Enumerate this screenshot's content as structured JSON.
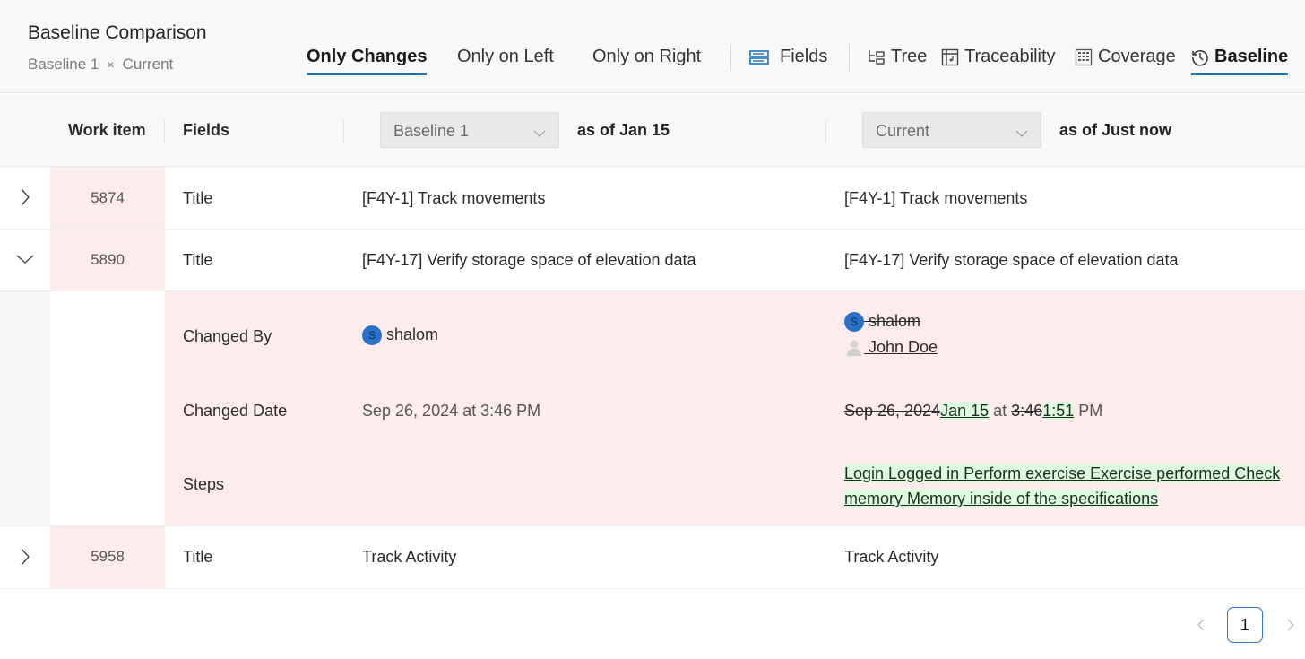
{
  "header": {
    "title": "Baseline Comparison",
    "subtitle_left": "Baseline 1",
    "subtitle_sep": "×",
    "subtitle_right": "Current"
  },
  "filters": [
    {
      "label": "Only Changes",
      "active": true
    },
    {
      "label": "Only on Left",
      "active": false
    },
    {
      "label": "Only on Right",
      "active": false
    }
  ],
  "fields_button": {
    "label": "Fields",
    "icon": "fields-icon"
  },
  "views": [
    {
      "label": "Tree",
      "icon": "tree-icon",
      "active": false
    },
    {
      "label": "Traceability",
      "icon": "traceability-icon",
      "active": false
    },
    {
      "label": "Coverage",
      "icon": "coverage-icon",
      "active": false
    },
    {
      "label": "Baseline",
      "icon": "history-icon",
      "active": true
    }
  ],
  "columns": {
    "work_item": "Work item",
    "fields": "Fields",
    "left_select": "Baseline 1",
    "left_asof": "as of Jan 15",
    "right_select": "Current",
    "right_asof": "as of Just now"
  },
  "rows": [
    {
      "id": "5874",
      "expanded": false,
      "field": "Title",
      "left": "[F4Y-1] Track movements",
      "right": "[F4Y-1] Track movements"
    },
    {
      "id": "5890",
      "expanded": true,
      "field": "Title",
      "left": "[F4Y-17] Verify storage space of elevation data",
      "right": "[F4Y-17] Verify storage space of elevation data"
    },
    {
      "id": "5958",
      "expanded": false,
      "field": "Title",
      "left": "Track Activity",
      "right": "Track Activity"
    }
  ],
  "details": {
    "changed_by": {
      "label": "Changed By",
      "left_avatar": "S",
      "left_user": "shalom",
      "right_removed_avatar": "S",
      "right_removed_user": " shalom",
      "right_added_user": " John Doe"
    },
    "changed_date": {
      "label": "Changed Date",
      "left": "Sep 26, 2024 at 3:46 PM",
      "right_removed_date": "Sep 26, 2024",
      "right_added_date": "Jan 15",
      "right_at": " at ",
      "right_removed_time": "3:46",
      "right_added_time": "1:51",
      "right_suffix": " PM"
    },
    "steps": {
      "label": "Steps",
      "left": "",
      "right_added_line1": "Login Logged in Perform exercise Exercise performed Check",
      "right_added_line2": "memory Memory inside of the specifications"
    }
  },
  "pagination": {
    "current": "1"
  },
  "colors": {
    "accent": "#1a73c0",
    "changed_bg": "#fdecec",
    "added_bg": "#dcfadf"
  }
}
